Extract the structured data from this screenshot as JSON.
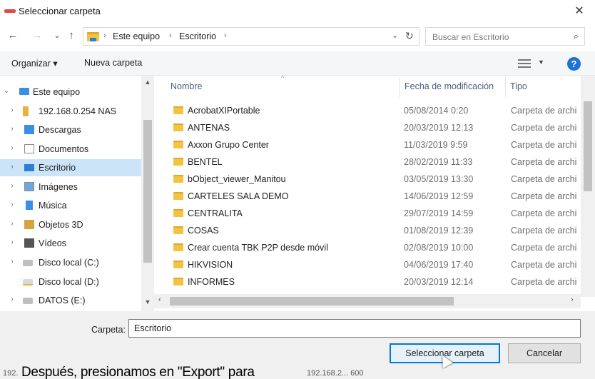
{
  "window": {
    "title": "Seleccionar carpeta",
    "close_glyph": "✕"
  },
  "navigation": {
    "back_glyph": "←",
    "forward_glyph": "→",
    "recent_glyph": "⌄",
    "up_glyph": "↑",
    "breadcrumb": [
      "Este equipo",
      "Escritorio"
    ],
    "separator_glyph": "›",
    "dropdown_glyph": "⌄",
    "refresh_glyph": "↻",
    "search_placeholder": "Buscar en Escritorio",
    "search_glyph": "⌕"
  },
  "toolbar": {
    "organize_label": "Organizar ▾",
    "new_folder_label": "Nueva carpeta",
    "view_dropdown_glyph": "▼",
    "help_glyph": "?"
  },
  "sidebar": {
    "scroll_up_glyph": "▲",
    "scroll_down_glyph": "▼",
    "items": [
      {
        "label": "Este equipo",
        "chevron": "⌄",
        "icon": "pc"
      },
      {
        "label": "192.168.0.254 NAS",
        "chevron": "›",
        "icon": "nas"
      },
      {
        "label": "Descargas",
        "chevron": "›",
        "icon": "dl"
      },
      {
        "label": "Documentos",
        "chevron": "›",
        "icon": "doc"
      },
      {
        "label": "Escritorio",
        "chevron": "›",
        "icon": "desk"
      },
      {
        "label": "Imágenes",
        "chevron": "›",
        "icon": "img"
      },
      {
        "label": "Música",
        "chevron": "›",
        "icon": "mus"
      },
      {
        "label": "Objetos 3D",
        "chevron": "›",
        "icon": "obj"
      },
      {
        "label": "Vídeos",
        "chevron": "›",
        "icon": "vid"
      },
      {
        "label": "Disco local (C:)",
        "chevron": "›",
        "icon": "drv"
      },
      {
        "label": "Disco local (D:)",
        "chevron": "",
        "icon": "drvd"
      },
      {
        "label": "DATOS (E:)",
        "chevron": "›",
        "icon": "drv"
      }
    ]
  },
  "file_list": {
    "columns": {
      "name": "Nombre",
      "date": "Fecha de modificación",
      "type": "Tipo"
    },
    "sort_glyph": "^",
    "rows": [
      {
        "name": "AcrobatXIPortable",
        "date": "05/08/2014 0:20",
        "type": "Carpeta de archi"
      },
      {
        "name": "ANTENAS",
        "date": "20/03/2019 12:13",
        "type": "Carpeta de archi"
      },
      {
        "name": "Axxon Grupo Center",
        "date": "11/03/2019 9:59",
        "type": "Carpeta de archi"
      },
      {
        "name": "BENTEL",
        "date": "28/02/2019 11:33",
        "type": "Carpeta de archi"
      },
      {
        "name": "bObject_viewer_Manitou",
        "date": "03/05/2019 13:30",
        "type": "Carpeta de archi"
      },
      {
        "name": "CARTELES SALA DEMO",
        "date": "14/06/2019 12:59",
        "type": "Carpeta de archi"
      },
      {
        "name": "CENTRALITA",
        "date": "29/07/2019 14:59",
        "type": "Carpeta de archi"
      },
      {
        "name": "COSAS",
        "date": "01/08/2019 12:39",
        "type": "Carpeta de archi"
      },
      {
        "name": "Crear cuenta TBK P2P desde móvil",
        "date": "02/08/2019 10:00",
        "type": "Carpeta de archi"
      },
      {
        "name": "HIKVISION",
        "date": "04/06/2019 17:40",
        "type": "Carpeta de archi"
      },
      {
        "name": "INFORMES",
        "date": "20/03/2019 12:14",
        "type": "Carpeta de archi"
      }
    ],
    "hscroll_left_glyph": "‹",
    "hscroll_right_glyph": "›"
  },
  "footer": {
    "folder_label": "Carpeta:",
    "folder_value": "Escritorio",
    "select_button": "Seleccionar carpeta",
    "cancel_button": "Cancelar"
  },
  "overlay": {
    "caption": "Después, presionamos en \"Export\" para",
    "bg_left": "192.",
    "bg_right": "192.168.2...  600"
  }
}
